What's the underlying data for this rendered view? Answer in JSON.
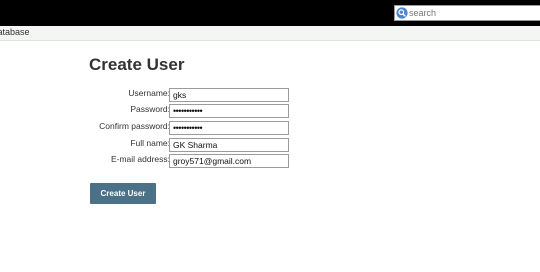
{
  "header": {
    "search": {
      "placeholder": "search"
    }
  },
  "breadcrumb": {
    "text": "Database"
  },
  "form": {
    "title": "Create User",
    "fields": [
      {
        "label": "Username:",
        "value": "gks",
        "type": "text"
      },
      {
        "label": "Password:",
        "value": "passwords12",
        "type": "password"
      },
      {
        "label": "Confirm password:",
        "value": "passwords12",
        "type": "password"
      },
      {
        "label": "Full name:",
        "value": "GK Sharma",
        "type": "text"
      },
      {
        "label": "E-mail address:",
        "value": "groy571@gmail.com",
        "type": "text"
      }
    ],
    "submit_label": "Create User"
  },
  "colors": {
    "topbar": "#000000",
    "button": "#4a7187",
    "crumbbar": "#f4f6f3"
  }
}
